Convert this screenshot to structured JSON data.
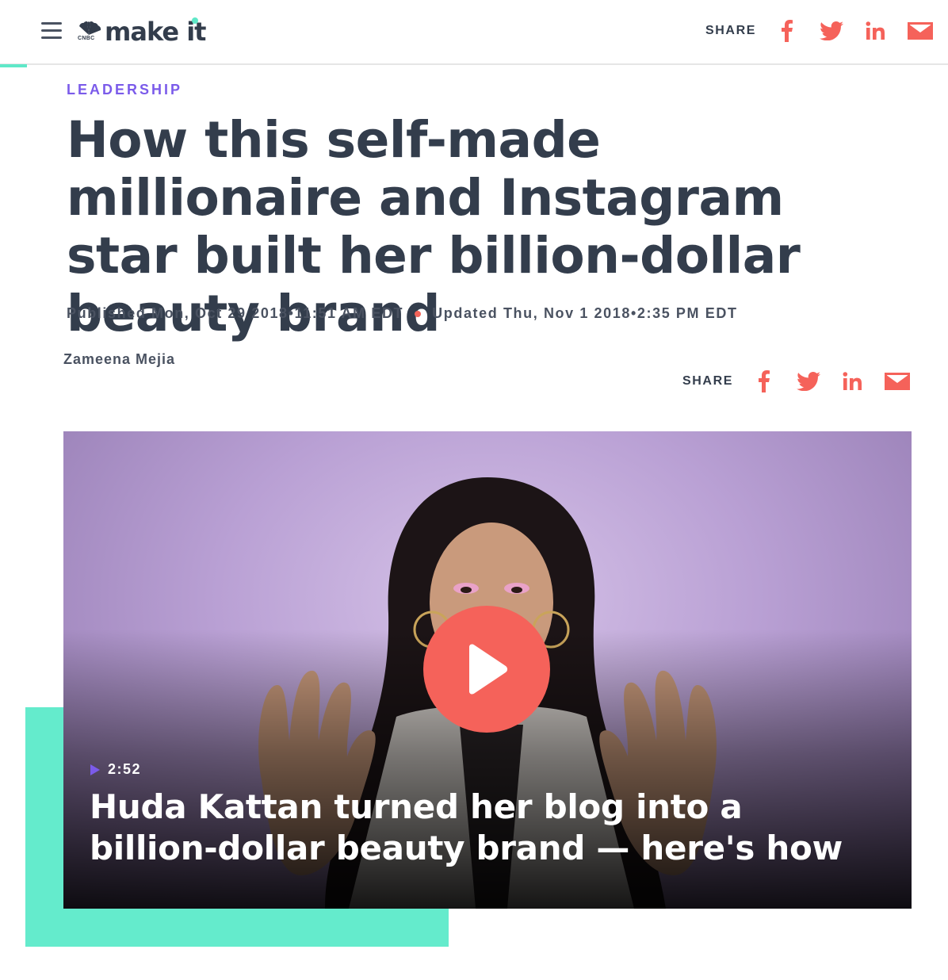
{
  "header": {
    "logo_text": "make it",
    "logo_network": "CNBC",
    "share_label": "SHARE",
    "share_icons": [
      "facebook-icon",
      "twitter-icon",
      "linkedin-icon",
      "email-icon"
    ],
    "accent_color": "#5fe8c8"
  },
  "article": {
    "category": "LEADERSHIP",
    "headline": "How this self-made millionaire and Instagram star built her billion-dollar beauty brand",
    "published": "Published Mon, Oct 29 2018•11:51 AM EDT",
    "updated": "Updated Thu, Nov 1 2018•2:35 PM EDT",
    "author": "Zameena Mejia",
    "share_label": "SHARE"
  },
  "video": {
    "duration": "2:52",
    "title": "Huda Kattan turned her blog into a billion-dollar beauty brand — here's how"
  },
  "colors": {
    "share_icon": "#f5625a",
    "category": "#7b5bea",
    "teal": "#64ebcc",
    "play_button": "#f5625a"
  }
}
